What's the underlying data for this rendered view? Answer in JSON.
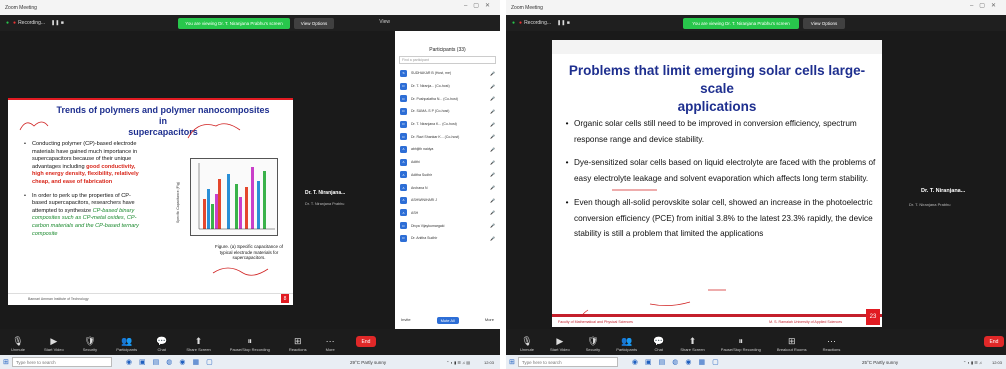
{
  "left": {
    "title_bar": "Zoom Meeting",
    "recording": "Recording...",
    "viewing_banner": "You are viewing Dr. T. Niranjana Prabhu's screen",
    "view_options": "View Options",
    "view_button": "View",
    "slide": {
      "title_line1": "Trends of polymers and polymer nanocomposites in",
      "title_line2": "supercapacitors",
      "bullet1_a": "Conducting polymer (CP)-based electrode materials have gained much importance in supercapacitors because of their unique advantages including ",
      "bullet1_b": "good conductivity, high energy density, flexibility, relatively cheap, and ease of fabrication",
      "bullet2_a": "In order to perk up the properties of CP-based supercapacitors, researchers have attempted to synthesize ",
      "bullet2_b": "CP-based binary composites such as CP-metal oxides, CP-carbon materials and the CP-based ternary composite",
      "figure_caption": "Figure. (a) Specific capacitance of typical electrode materials for supercapacitors.",
      "y_axis_label": "Specific Capacitance (F/g)",
      "footer": "Bannari Amman Institute of Technology",
      "slide_number": "8"
    },
    "speaker": {
      "name": "Dr. T. Niranjana...",
      "sub": "Dr. T. Niranjana Prabhu"
    },
    "participants": {
      "header": "Participants (33)",
      "search": "Find a participant",
      "list": [
        {
          "initials": "S",
          "name": "SUDHAKAR B (Host, me)"
        },
        {
          "initials": "D",
          "name": "Dr. T. Niranja... (Co-host)"
        },
        {
          "initials": "D",
          "name": "Dr. Pushpalatha N... (Co-host)"
        },
        {
          "initials": "D",
          "name": "Dr. SUMA .S P (Co-host)"
        },
        {
          "initials": "D",
          "name": "Dr. T. Niranjana K... (Co-host)"
        },
        {
          "initials": "D",
          "name": "Dr. Ravi Shankar K... (Co-host)"
        },
        {
          "initials": "A",
          "name": "abhijith naidya"
        },
        {
          "initials": "A",
          "name": "Adithi"
        },
        {
          "initials": "A",
          "name": "Aditha Sudhir"
        },
        {
          "initials": "A",
          "name": "Archana N"
        },
        {
          "initials": "A",
          "name": "ASHWINIHARI J"
        },
        {
          "initials": "A",
          "name": "ASH"
        },
        {
          "initials": "D",
          "name": "Divya Vijaykumargaki"
        },
        {
          "initials": "D",
          "name": "Dr. Anitha Sudhir"
        }
      ],
      "invite": "Invite",
      "mute_all": "Mute All",
      "more": "More"
    },
    "toolbar": [
      "Unmute",
      "Start Video",
      "Security",
      "Participants",
      "Chat",
      "Share Screen",
      "Pause/Stop Recording",
      "Reactions",
      "More"
    ],
    "participants_count": "33",
    "end": "End"
  },
  "right": {
    "title_bar": "Zoom Meeting",
    "recording": "Recording...",
    "viewing_banner": "You are viewing Dr. T. Niranjana Prabhu's screen",
    "view_options": "View Options",
    "slide": {
      "title_line1": "Problems that limit emerging solar cells large-scale",
      "title_line2": "applications",
      "bullets": [
        "Organic solar cells still need to be improved in conversion efficiency, spectrum response range and device stability.",
        "Dye-sensitized solar cells based on liquid electrolyte are faced with the problems of easy electrolyte leakage and solvent evaporation which affects long term stability.",
        "Even though all-solid perovskite solar cell, showed an increase in the photoelectric conversion efficiency (PCE) from initial 3.8% to the latest 23.3% rapidly, the device stability is still a problem that limited the applications"
      ],
      "footer_left": "Faculty of Mathematical and Physical Sciences",
      "footer_right": "M. S. Ramaiah University of Applied Sciences",
      "slide_number": "23"
    },
    "speaker": {
      "name": "Dr. T. Niranjana...",
      "sub": "Dr. T. Niranjana Prabhu"
    },
    "toolbar": [
      "Unmute",
      "Start Video",
      "Security",
      "Participants",
      "Chat",
      "Share Screen",
      "Pause/Stop Recording",
      "Breakout Rooms",
      "Reactions"
    ],
    "participants_count": "32",
    "end": "End"
  },
  "taskbar": {
    "search_placeholder": "Type here to search",
    "weather_left": "29°C  Partly sunny",
    "weather_right": "25°C  Partly sunny",
    "time": "12:03",
    "date": "29-10-2021"
  }
}
